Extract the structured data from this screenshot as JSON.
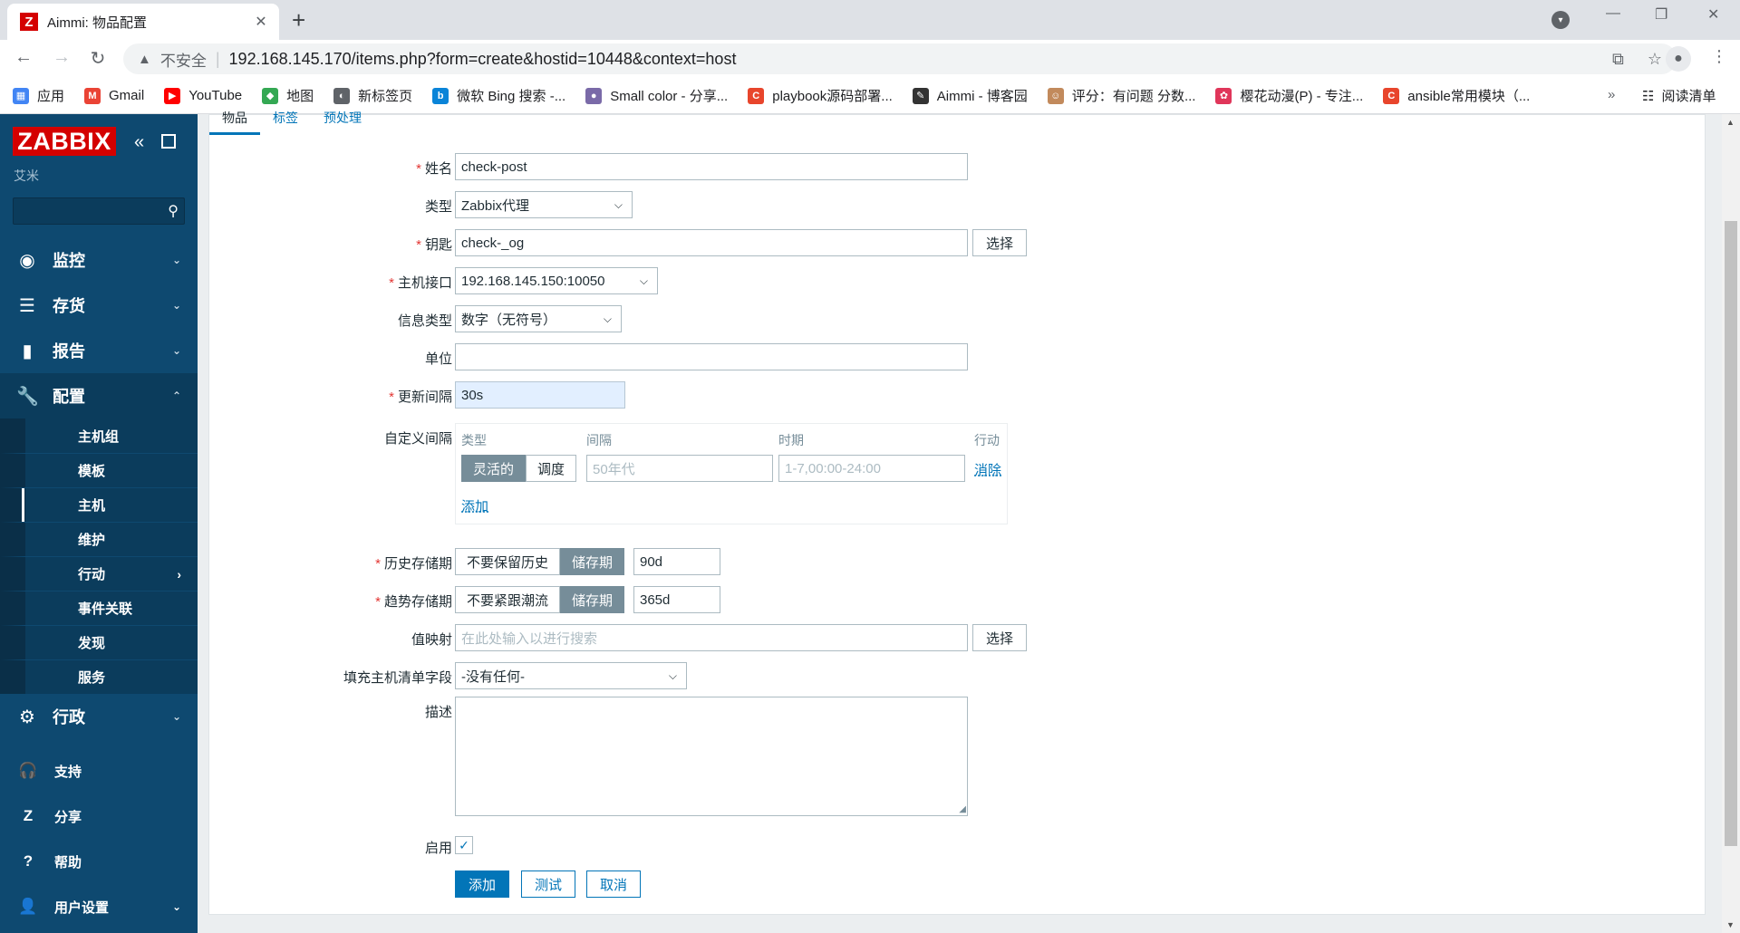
{
  "browser": {
    "tab_title": "Aimmi: 物品配置",
    "tab_favicon": "Z",
    "not_secure": "不安全",
    "url": "192.168.145.170/items.php?form=create&hostid=10448&context=host",
    "bookmarks": [
      {
        "label": "应用",
        "color": "#4285f4",
        "glyph": "▦"
      },
      {
        "label": "Gmail",
        "color": "#ea4335",
        "glyph": "M"
      },
      {
        "label": "YouTube",
        "color": "#ff0000",
        "glyph": "▶"
      },
      {
        "label": "地图",
        "color": "#34a853",
        "glyph": "◆"
      },
      {
        "label": "新标签页",
        "color": "#5f6368",
        "glyph": "◐"
      },
      {
        "label": "微软 Bing 搜索 -...",
        "color": "#0a84d8",
        "glyph": "b"
      },
      {
        "label": "Small color - 分享...",
        "color": "#7a6aa8",
        "glyph": "●"
      },
      {
        "label": "playbook源码部署...",
        "color": "#e8452c",
        "glyph": "C"
      },
      {
        "label": "Aimmi - 博客园",
        "color": "#333333",
        "glyph": "✎"
      },
      {
        "label": "评分：有问题 分数...",
        "color": "#c28a5c",
        "glyph": "☺"
      },
      {
        "label": "樱花动漫(P) - 专注...",
        "color": "#e0365a",
        "glyph": "✿"
      },
      {
        "label": "ansible常用模块（...",
        "color": "#e8452c",
        "glyph": "C"
      }
    ],
    "more": "»",
    "reading_list": "阅读清单"
  },
  "sidebar": {
    "logo": "ZABBIX",
    "server_name": "艾米",
    "menu": [
      {
        "label": "监控",
        "icon": "◉"
      },
      {
        "label": "存货",
        "icon": "☰"
      },
      {
        "label": "报告",
        "icon": "▮"
      },
      {
        "label": "配置",
        "icon": "🔧"
      }
    ],
    "submenu": [
      {
        "label": "主机组"
      },
      {
        "label": "模板"
      },
      {
        "label": "主机"
      },
      {
        "label": "维护"
      },
      {
        "label": "行动"
      },
      {
        "label": "事件关联"
      },
      {
        "label": "发现"
      },
      {
        "label": "服务"
      }
    ],
    "admin": {
      "label": "行政",
      "icon": "⚙"
    },
    "bottom": [
      {
        "label": "支持",
        "icon": "🎧"
      },
      {
        "label": "分享",
        "icon": "Z"
      },
      {
        "label": "帮助",
        "icon": "?"
      },
      {
        "label": "用户设置",
        "icon": "👤"
      }
    ]
  },
  "form": {
    "tabs": [
      "物品",
      "标签",
      "预处理"
    ],
    "name_label": "姓名",
    "name_value": "check-post",
    "type_label": "类型",
    "type_value": "Zabbix代理",
    "key_label": "钥匙",
    "key_value": "check-_og",
    "select_label": "选择",
    "interface_label": "主机接口",
    "interface_value": "192.168.145.150:10050",
    "info_type_label": "信息类型",
    "info_type_value": "数字（无符号）",
    "units_label": "单位",
    "units_value": "",
    "update_label": "更新间隔",
    "update_value": "30s",
    "custom_label": "自定义间隔",
    "custom_headers": {
      "type": "类型",
      "interval": "间隔",
      "period": "时期",
      "action": "行动"
    },
    "custom_flex": "灵活的",
    "custom_sched": "调度",
    "custom_interval_ph": "50年代",
    "custom_period_ph": "1-7,00:00-24:00",
    "custom_remove": "消除",
    "custom_add": "添加",
    "history_label": "历史存储期",
    "history_off": "不要保留历史",
    "history_on": "储存期",
    "history_value": "90d",
    "trends_label": "趋势存储期",
    "trends_off": "不要紧跟潮流",
    "trends_on": "储存期",
    "trends_value": "365d",
    "valuemap_label": "值映射",
    "valuemap_ph": "在此处输入以进行搜索",
    "inventory_label": "填充主机清单字段",
    "inventory_value": "-没有任何-",
    "desc_label": "描述",
    "enabled_label": "启用",
    "btn_add": "添加",
    "btn_test": "测试",
    "btn_cancel": "取消"
  }
}
